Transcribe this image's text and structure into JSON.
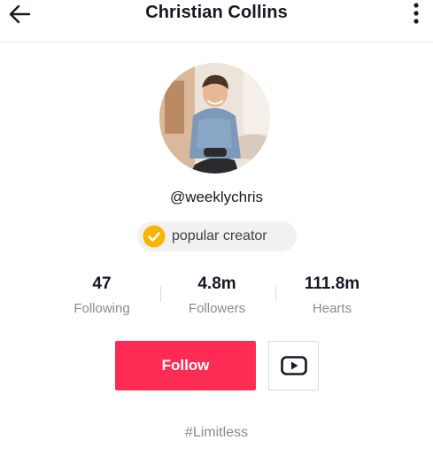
{
  "header": {
    "title": "Christian Collins",
    "back_icon": "arrow-left-icon",
    "more_icon": "more-vertical-icon"
  },
  "profile": {
    "username": "@weeklychris",
    "badge": {
      "icon": "check-circle-icon",
      "label": "popular creator",
      "color": "#f7b500"
    }
  },
  "stats": [
    {
      "value": "47",
      "label": "Following"
    },
    {
      "value": "4.8m",
      "label": "Followers"
    },
    {
      "value": "111.8m",
      "label": "Hearts"
    }
  ],
  "actions": {
    "follow_label": "Follow",
    "follow_color": "#fe2c55",
    "youtube_icon": "youtube-icon"
  },
  "bio": "#Limitless"
}
